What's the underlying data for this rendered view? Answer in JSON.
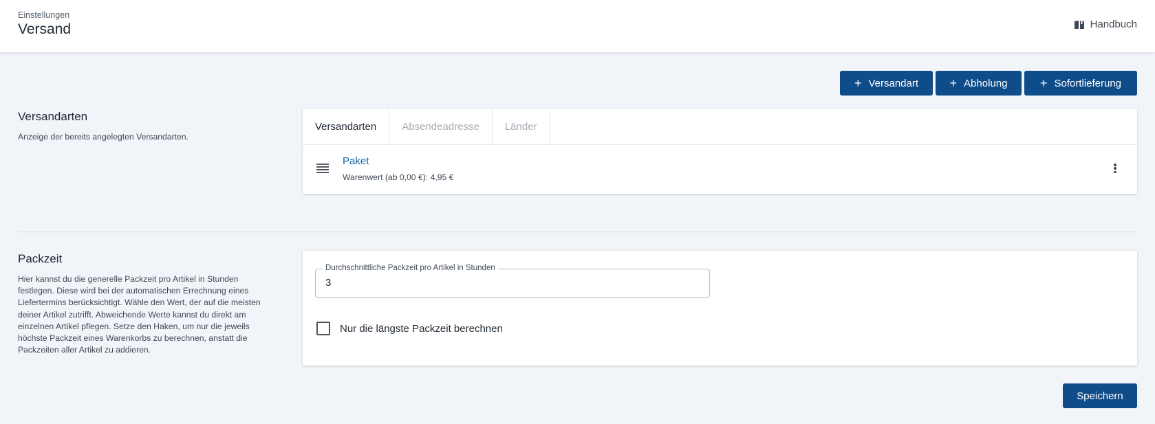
{
  "header": {
    "breadcrumb": "Einstellungen",
    "title": "Versand",
    "manual_label": "Handbuch",
    "manual_icon": "book-icon"
  },
  "actions": {
    "add_versandart": "Versandart",
    "add_abholung": "Abholung",
    "add_sofortlieferung": "Sofortlieferung",
    "plus_glyph": "+"
  },
  "versandarten_section": {
    "title": "Versandarten",
    "description": "Anzeige der bereits angelegten Versandarten.",
    "tabs": [
      {
        "label": "Versandarten",
        "active": true
      },
      {
        "label": "Absendeadresse",
        "active": false
      },
      {
        "label": "Länder",
        "active": false
      }
    ],
    "items": [
      {
        "name": "Paket",
        "detail": "Warenwert (ab 0,00 €): 4,95 €"
      }
    ]
  },
  "packzeit_section": {
    "title": "Packzeit",
    "description": "Hier kannst du die generelle Packzeit pro Artikel in Stunden festlegen. Diese wird bei der automatischen Errechnung eines Liefertermins berücksichtigt. Wähle den Wert, der auf die meisten deiner Artikel zutrifft. Abweichende Werte kannst du direkt am einzelnen Artikel pflegen. Setze den Haken, um nur die jeweils höchste Packzeit eines Warenkorbs zu berechnen, anstatt die Packzeiten aller Artikel zu addieren.",
    "field_label": "Durchschnittliche Packzeit pro Artikel in Stunden",
    "field_value": "3",
    "checkbox_label": "Nur die längste Packzeit berechnen",
    "checkbox_checked": false
  },
  "footer": {
    "save_label": "Speichern"
  },
  "colors": {
    "primary": "#0f4c8a",
    "link": "#1565a8",
    "background": "#f1f4f8"
  }
}
